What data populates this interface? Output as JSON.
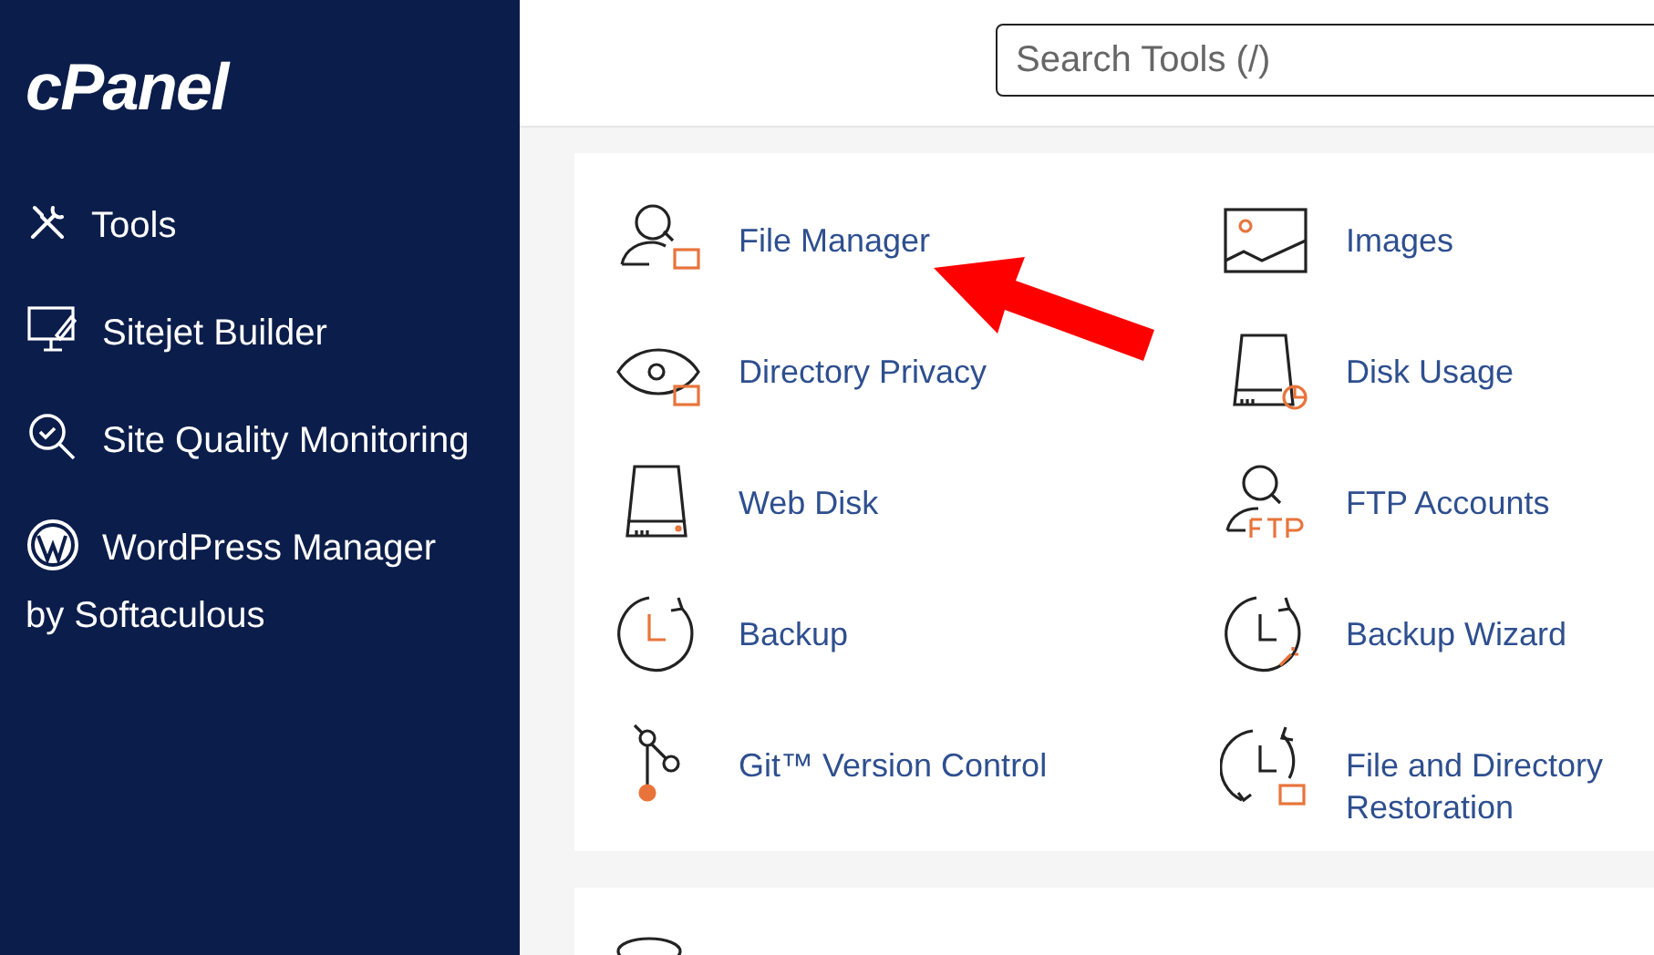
{
  "sidebar": {
    "logo": "cPanel",
    "items": [
      {
        "label": "Tools"
      },
      {
        "label": "Sitejet Builder"
      },
      {
        "label": "Site Quality Monitoring"
      },
      {
        "label": "WordPress Manager by Softaculous"
      }
    ]
  },
  "search": {
    "placeholder": "Search Tools (/)"
  },
  "tools": [
    {
      "label": "File Manager"
    },
    {
      "label": "Images"
    },
    {
      "label": "Directory Privacy"
    },
    {
      "label": "Disk Usage"
    },
    {
      "label": "Web Disk"
    },
    {
      "label": "FTP Accounts"
    },
    {
      "label": "Backup"
    },
    {
      "label": "Backup Wizard"
    },
    {
      "label": "Git™ Version Control"
    },
    {
      "label": "File and Directory Restoration"
    }
  ]
}
